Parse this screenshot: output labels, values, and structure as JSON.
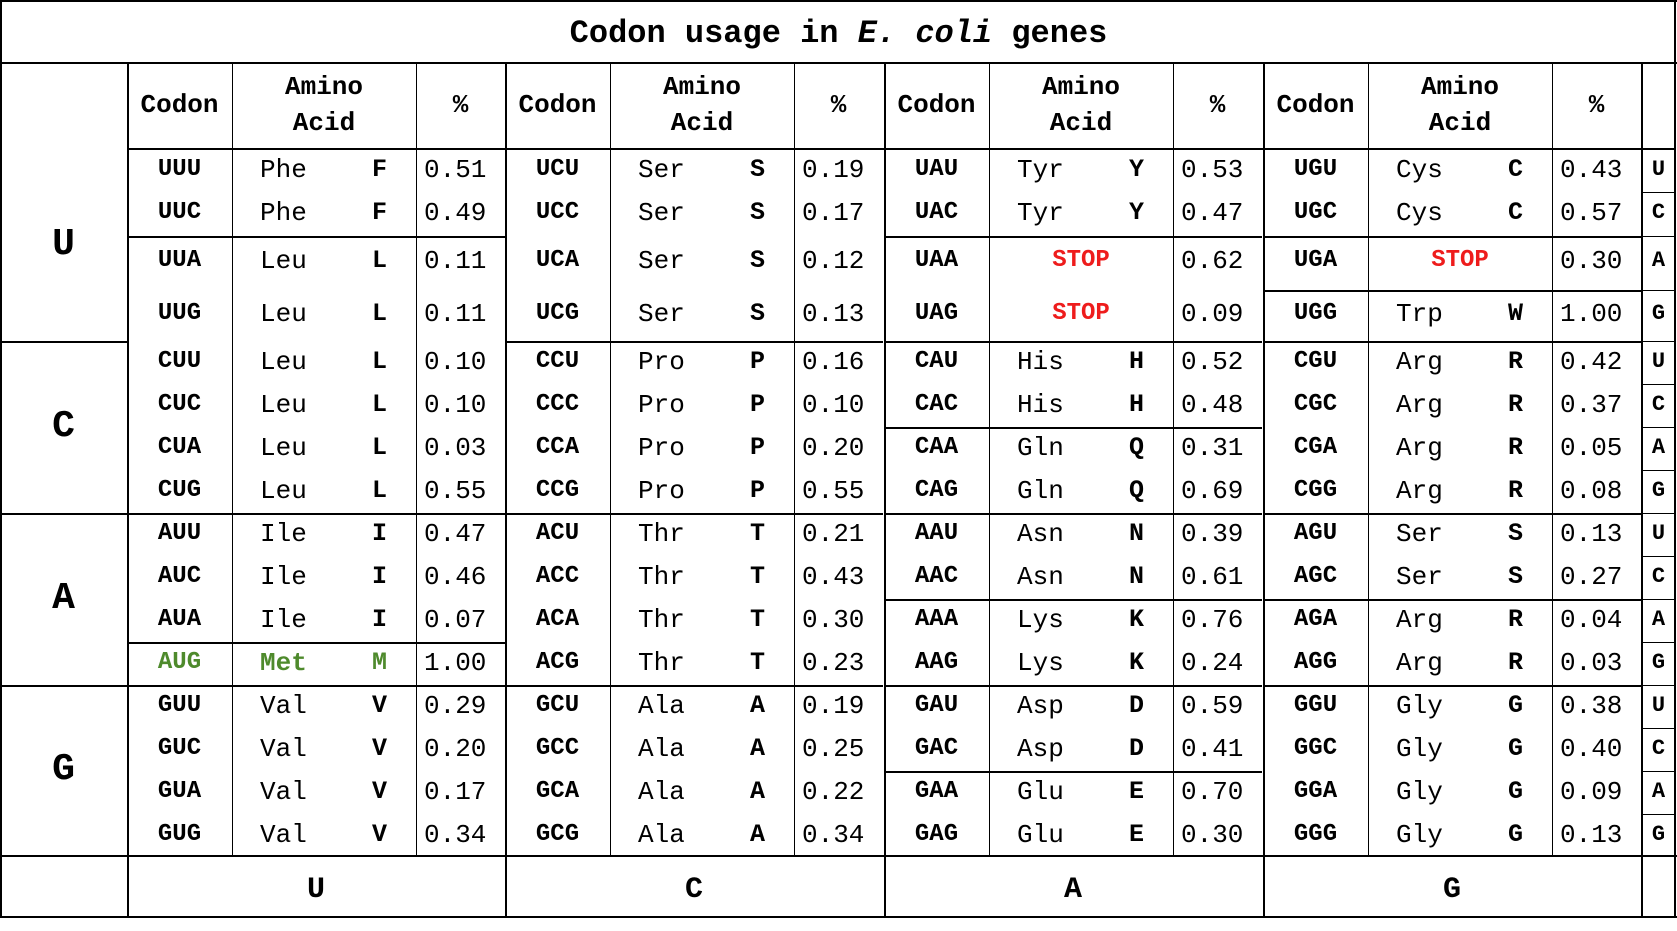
{
  "title": {
    "pre": "Codon usage in",
    "italic": "E. coli",
    "post": "genes"
  },
  "headers": {
    "codon": "Codon",
    "amino_line1": "Amino",
    "amino_line2": "Acid",
    "pct": "%"
  },
  "first_bases": [
    "U",
    "C",
    "A",
    "G"
  ],
  "second_bases": [
    "U",
    "C",
    "A",
    "G"
  ],
  "third_bases": [
    "U",
    "C",
    "A",
    "G"
  ],
  "colors": {
    "stop": "#ee1c1c",
    "start": "#4e8a2c",
    "border": "#000000"
  },
  "blocks": [
    {
      "first": "U",
      "columns": [
        [
          {
            "codon": "UUU",
            "aa": "Phe",
            "letter": "F",
            "pct": "0.51"
          },
          {
            "codon": "UUC",
            "aa": "Phe",
            "letter": "F",
            "pct": "0.49"
          },
          {
            "codon": "UUA",
            "aa": "Leu",
            "letter": "L",
            "pct": "0.11"
          },
          {
            "codon": "UUG",
            "aa": "Leu",
            "letter": "L",
            "pct": "0.11"
          }
        ],
        [
          {
            "codon": "UCU",
            "aa": "Ser",
            "letter": "S",
            "pct": "0.19"
          },
          {
            "codon": "UCC",
            "aa": "Ser",
            "letter": "S",
            "pct": "0.17"
          },
          {
            "codon": "UCA",
            "aa": "Ser",
            "letter": "S",
            "pct": "0.12"
          },
          {
            "codon": "UCG",
            "aa": "Ser",
            "letter": "S",
            "pct": "0.13"
          }
        ],
        [
          {
            "codon": "UAU",
            "aa": "Tyr",
            "letter": "Y",
            "pct": "0.53"
          },
          {
            "codon": "UAC",
            "aa": "Tyr",
            "letter": "Y",
            "pct": "0.47"
          },
          {
            "codon": "UAA",
            "stop": "STOP",
            "pct": "0.62"
          },
          {
            "codon": "UAG",
            "stop": "STOP",
            "pct": "0.09"
          }
        ],
        [
          {
            "codon": "UGU",
            "aa": "Cys",
            "letter": "C",
            "pct": "0.43"
          },
          {
            "codon": "UGC",
            "aa": "Cys",
            "letter": "C",
            "pct": "0.57"
          },
          {
            "codon": "UGA",
            "stop": "STOP",
            "pct": "0.30"
          },
          {
            "codon": "UGG",
            "aa": "Trp",
            "letter": "W",
            "pct": "1.00"
          }
        ]
      ]
    },
    {
      "first": "C",
      "columns": [
        [
          {
            "codon": "CUU",
            "aa": "Leu",
            "letter": "L",
            "pct": "0.10"
          },
          {
            "codon": "CUC",
            "aa": "Leu",
            "letter": "L",
            "pct": "0.10"
          },
          {
            "codon": "CUA",
            "aa": "Leu",
            "letter": "L",
            "pct": "0.03"
          },
          {
            "codon": "CUG",
            "aa": "Leu",
            "letter": "L",
            "pct": "0.55"
          }
        ],
        [
          {
            "codon": "CCU",
            "aa": "Pro",
            "letter": "P",
            "pct": "0.16"
          },
          {
            "codon": "CCC",
            "aa": "Pro",
            "letter": "P",
            "pct": "0.10"
          },
          {
            "codon": "CCA",
            "aa": "Pro",
            "letter": "P",
            "pct": "0.20"
          },
          {
            "codon": "CCG",
            "aa": "Pro",
            "letter": "P",
            "pct": "0.55"
          }
        ],
        [
          {
            "codon": "CAU",
            "aa": "His",
            "letter": "H",
            "pct": "0.52"
          },
          {
            "codon": "CAC",
            "aa": "His",
            "letter": "H",
            "pct": "0.48"
          },
          {
            "codon": "CAA",
            "aa": "Gln",
            "letter": "Q",
            "pct": "0.31"
          },
          {
            "codon": "CAG",
            "aa": "Gln",
            "letter": "Q",
            "pct": "0.69"
          }
        ],
        [
          {
            "codon": "CGU",
            "aa": "Arg",
            "letter": "R",
            "pct": "0.42"
          },
          {
            "codon": "CGC",
            "aa": "Arg",
            "letter": "R",
            "pct": "0.37"
          },
          {
            "codon": "CGA",
            "aa": "Arg",
            "letter": "R",
            "pct": "0.05"
          },
          {
            "codon": "CGG",
            "aa": "Arg",
            "letter": "R",
            "pct": "0.08"
          }
        ]
      ]
    },
    {
      "first": "A",
      "columns": [
        [
          {
            "codon": "AUU",
            "aa": "Ile",
            "letter": "I",
            "pct": "0.47"
          },
          {
            "codon": "AUC",
            "aa": "Ile",
            "letter": "I",
            "pct": "0.46"
          },
          {
            "codon": "AUA",
            "aa": "Ile",
            "letter": "I",
            "pct": "0.07"
          },
          {
            "codon": "AUG",
            "aa": "Met",
            "letter": "M",
            "pct": "1.00",
            "start": true
          }
        ],
        [
          {
            "codon": "ACU",
            "aa": "Thr",
            "letter": "T",
            "pct": "0.21"
          },
          {
            "codon": "ACC",
            "aa": "Thr",
            "letter": "T",
            "pct": "0.43"
          },
          {
            "codon": "ACA",
            "aa": "Thr",
            "letter": "T",
            "pct": "0.30"
          },
          {
            "codon": "ACG",
            "aa": "Thr",
            "letter": "T",
            "pct": "0.23"
          }
        ],
        [
          {
            "codon": "AAU",
            "aa": "Asn",
            "letter": "N",
            "pct": "0.39"
          },
          {
            "codon": "AAC",
            "aa": "Asn",
            "letter": "N",
            "pct": "0.61"
          },
          {
            "codon": "AAA",
            "aa": "Lys",
            "letter": "K",
            "pct": "0.76"
          },
          {
            "codon": "AAG",
            "aa": "Lys",
            "letter": "K",
            "pct": "0.24"
          }
        ],
        [
          {
            "codon": "AGU",
            "aa": "Ser",
            "letter": "S",
            "pct": "0.13"
          },
          {
            "codon": "AGC",
            "aa": "Ser",
            "letter": "S",
            "pct": "0.27"
          },
          {
            "codon": "AGA",
            "aa": "Arg",
            "letter": "R",
            "pct": "0.04"
          },
          {
            "codon": "AGG",
            "aa": "Arg",
            "letter": "R",
            "pct": "0.03"
          }
        ]
      ]
    },
    {
      "first": "G",
      "columns": [
        [
          {
            "codon": "GUU",
            "aa": "Val",
            "letter": "V",
            "pct": "0.29"
          },
          {
            "codon": "GUC",
            "aa": "Val",
            "letter": "V",
            "pct": "0.20"
          },
          {
            "codon": "GUA",
            "aa": "Val",
            "letter": "V",
            "pct": "0.17"
          },
          {
            "codon": "GUG",
            "aa": "Val",
            "letter": "V",
            "pct": "0.34"
          }
        ],
        [
          {
            "codon": "GCU",
            "aa": "Ala",
            "letter": "A",
            "pct": "0.19"
          },
          {
            "codon": "GCC",
            "aa": "Ala",
            "letter": "A",
            "pct": "0.25"
          },
          {
            "codon": "GCA",
            "aa": "Ala",
            "letter": "A",
            "pct": "0.22"
          },
          {
            "codon": "GCG",
            "aa": "Ala",
            "letter": "A",
            "pct": "0.34"
          }
        ],
        [
          {
            "codon": "GAU",
            "aa": "Asp",
            "letter": "D",
            "pct": "0.59"
          },
          {
            "codon": "GAC",
            "aa": "Asp",
            "letter": "D",
            "pct": "0.41"
          },
          {
            "codon": "GAA",
            "aa": "Glu",
            "letter": "E",
            "pct": "0.70"
          },
          {
            "codon": "GAG",
            "aa": "Glu",
            "letter": "E",
            "pct": "0.30"
          }
        ],
        [
          {
            "codon": "GGU",
            "aa": "Gly",
            "letter": "G",
            "pct": "0.38"
          },
          {
            "codon": "GGC",
            "aa": "Gly",
            "letter": "G",
            "pct": "0.40"
          },
          {
            "codon": "GGA",
            "aa": "Gly",
            "letter": "G",
            "pct": "0.09"
          },
          {
            "codon": "GGG",
            "aa": "Gly",
            "letter": "G",
            "pct": "0.13"
          }
        ]
      ]
    }
  ]
}
